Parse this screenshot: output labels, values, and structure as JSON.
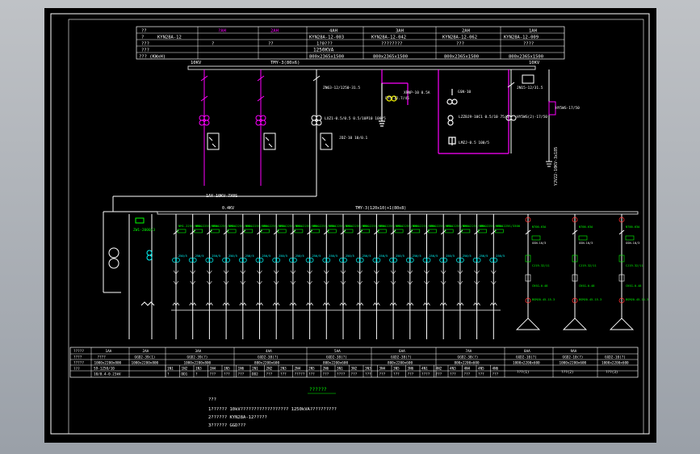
{
  "colors": {
    "background": "#000000",
    "frame": "#b9bcc2",
    "line_white": "#ffffff",
    "magenta": "#ff00ff",
    "green": "#00ff00",
    "cyan": "#00ffff",
    "yellow": "#ffff00",
    "red": "#ff3030"
  },
  "top_table": {
    "row1": [
      "??",
      "?AH",
      "2AH",
      "4AH",
      "3AH",
      "2AH",
      "1AH"
    ],
    "row2": [
      "?",
      "KYN28A-12",
      "",
      "KYN28A-12-003",
      "KYN28A-12-042",
      "KYN28A-12-062",
      "KYN28A-12-009"
    ],
    "row3": [
      "???",
      "?",
      "??",
      "1?0???",
      "????????",
      "???",
      "????"
    ],
    "row4": [
      "???",
      "",
      "1250KVA",
      "",
      "",
      "",
      ""
    ],
    "row5": [
      "??? (KWxH)",
      "",
      "800x2365x1500",
      "800x2365x1500",
      "800x2365x1500",
      "800x2365x1500"
    ]
  },
  "hv": {
    "left_label": "10KV",
    "bus_label": "TMY-3(80x6)",
    "right_label": "10KV",
    "cable_label": "YJV22-10KV-3x185",
    "transformer_label": "1AY-10KV 7X0S",
    "annotations": [
      "ZN63-12/1250-31.5",
      "LXZ1-0.5/0.5 0.5/10P10 100/5",
      "JDZ-10 10/0.1",
      "XRNP-10 0.5A",
      "FY5-12.7/45",
      "JN15-12/31.5",
      "HY5WS-17/50",
      "LZZBJ9-10C1 0.5/10 75/5",
      "LMZJ-0.5 100/5",
      "HY5WS(2)-17/50",
      "GSN-10"
    ]
  },
  "lv": {
    "bus_label": "0.4KV",
    "bus_label_2": "TMY-3(120x10)+1(80x8)",
    "incoming_label": "ZW1-2000/3",
    "branch_breaker": "NM1-225S/3300",
    "branch_ct": "LMZJ1-0.66",
    "branch_current": "250/5",
    "cap_breaker": "GSN-10/3",
    "cap_contactor": "CJ19-32/11",
    "cap_reactor": "CKSG-0.48",
    "cap_fuse": "NT00-63A",
    "cap_bank": "BSMJ0.45-15-3"
  },
  "bottom_table": {
    "row_labels": [
      "?????",
      "????",
      "?????",
      "???"
    ],
    "col_headers": [
      "1AA",
      "2AA",
      "3AA",
      "4AA",
      "5AA",
      "6AA",
      "7AA",
      "8AA",
      "9AA"
    ],
    "row1": [
      "1AA",
      "2AA",
      "3AA",
      "4AA",
      "5AA",
      "6AA",
      "7AA",
      "8AA",
      "9AA"
    ],
    "row2": [
      "????",
      "GGD2-39(1)",
      "GGD2-39(?)",
      "GGD2-38(?)",
      "GGD2-38(?)",
      "GGD2-38(?)",
      "GGD2-38(?)",
      "GGD2-10(?)",
      "GGD2-10(?)",
      "GGD2-10(?)"
    ],
    "row3": [
      "1000x2200x800",
      "1000x2200x800",
      "1000x2200x800",
      "800x2200x600",
      "800x2200x600",
      "800x2200x600",
      "800x2200x600",
      "1000x2200x600",
      "1000x2200x600",
      "1000x2200x600"
    ],
    "row4_left": [
      "???",
      "S9-1250/10",
      "10/0.4-0.23kV"
    ],
    "row4_cells": [
      "1N1",
      "1N2",
      "1N3",
      "1N4",
      "1N5",
      "1N6",
      "2N1",
      "2N2",
      "2N3",
      "2N4",
      "2N5",
      "2N6",
      "3N1",
      "3N2",
      "3N3",
      "3N4",
      "3N5",
      "3N6",
      "4N1",
      "4N2",
      "4N3",
      "4N4",
      "4N5",
      "4N6"
    ],
    "row5_cells": [
      "?",
      "DD1",
      "?",
      "???",
      "???",
      "???",
      "DD2",
      "???",
      "???",
      "?????",
      "???",
      "???",
      "????",
      "???",
      "???",
      "???",
      "???",
      "???",
      "????",
      "???",
      "???",
      "???",
      "???",
      "???"
    ],
    "cap_cells": [
      "???(1)",
      "???(2)",
      "???(3)"
    ]
  },
  "notes": {
    "title": "??????",
    "heading": "???",
    "line1": "1?????? 10kV?????????????????? 1250kVA??????????",
    "line2": "2?????? KYN28A-12?????",
    "line3": "3?????? GGD???"
  }
}
